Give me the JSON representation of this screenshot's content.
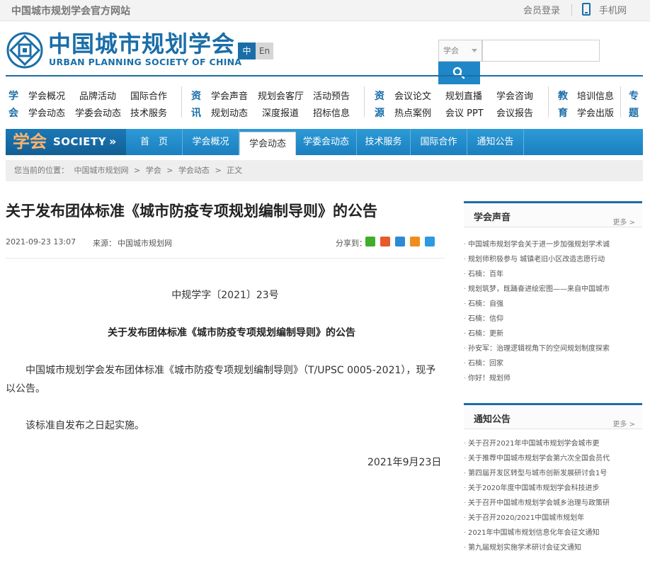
{
  "topbar": {
    "site_name": "中国城市规划学会官方网站",
    "login": "会员登录",
    "mobile": "手机网"
  },
  "header": {
    "logo_cn": "中国城市规划学会",
    "logo_en": "URBAN PLANNING SOCIETY OF CHINA",
    "lang_zh": "中",
    "lang_en": "En",
    "search_scope": "学会",
    "search_placeholder": ""
  },
  "category_nav": {
    "groups": [
      {
        "letters": [
          "学",
          "会"
        ],
        "links": [
          "学会概况",
          "品牌活动",
          "国际合作",
          "学会动态",
          "学委会动态",
          "技术服务"
        ]
      },
      {
        "letters": [
          "资",
          "讯"
        ],
        "links": [
          "学会声音",
          "规划会客厅",
          "活动预告",
          "规划动态",
          "深度报道",
          "招标信息"
        ]
      },
      {
        "letters": [
          "资",
          "源"
        ],
        "links": [
          "会议论文",
          "规划直播",
          "学会咨询",
          "热点案例",
          "会议 PPT",
          "会议报告"
        ]
      },
      {
        "letters": [
          "教",
          "育"
        ],
        "links": [
          "培训信息",
          "学会出版"
        ]
      },
      {
        "letters": [
          "专",
          "题"
        ],
        "links": []
      }
    ]
  },
  "main_nav": {
    "brand_cn": "学会",
    "brand_en": "SOCIETY",
    "brand_arrow": "»",
    "items": [
      "首　页",
      "学会概况",
      "学会动态",
      "学委会动态",
      "技术服务",
      "国际合作",
      "通知公告"
    ],
    "active_index": 2
  },
  "breadcrumb": [
    "您当前的位置：",
    "中国城市规划网",
    ">",
    "学会",
    ">",
    "学会动态",
    ">",
    "正文"
  ],
  "article": {
    "title": "关于发布团体标准《城市防疫专项规划编制导则》的公告",
    "date": "2021-09-23 13:07",
    "source_label": "来源：",
    "source": "中国城市规划网",
    "share_label": "分享到：",
    "share_icons": [
      "wechat-icon",
      "weibo-icon",
      "qzone-icon",
      "qq-icon",
      "tencent-weibo-icon"
    ],
    "doc_number": "中规学字〔2021〕23号",
    "heading": "关于发布团体标准《城市防疫专项规划编制导则》的公告",
    "paragraph1": "中国城市规划学会发布团体标准《城市防疫专项规划编制导则》（T/UPSC 0005-2021），现予以公告。",
    "paragraph2": "该标准自发布之日起实施。",
    "sign_date": "2021年9月23日"
  },
  "sidebar": {
    "voice": {
      "title": "学会声音",
      "more": "更多 >",
      "items": [
        "中国城市规划学会关于进一步加强规划学术诚",
        "规划师积极参与 城镇老旧小区改造志愿行动",
        "石楠：百年",
        "规划筑梦，既踊奋进绘宏图——来自中国城市",
        "石楠：自强",
        "石楠：信仰",
        "石楠：更新",
        "孙安军：治理逻辑视角下的空间规划制度探索",
        "石楠：回家",
        "你好！规划师"
      ]
    },
    "notices": {
      "title": "通知公告",
      "more": "更多 >",
      "items": [
        "关于召开2021年中国城市规划学会城市更",
        "关于推荐中国城市规划学会第六次全国会员代",
        "第四届开发区转型与城市创新发展研讨会1号",
        "关于2020年度中国城市规划学会科技进步",
        "关于召开中国城市规划学会城乡治理与政策研",
        "关于召开2020/2021中国城市规划年",
        "2021年中国城市规划信息化年会征文通知",
        "第九届规划实施学术研讨会征文通知"
      ]
    }
  },
  "colors": {
    "brand_blue": "#1a6ea8",
    "nav_blue": "#2d9ad6",
    "brand_orange": "#ffb36b"
  }
}
